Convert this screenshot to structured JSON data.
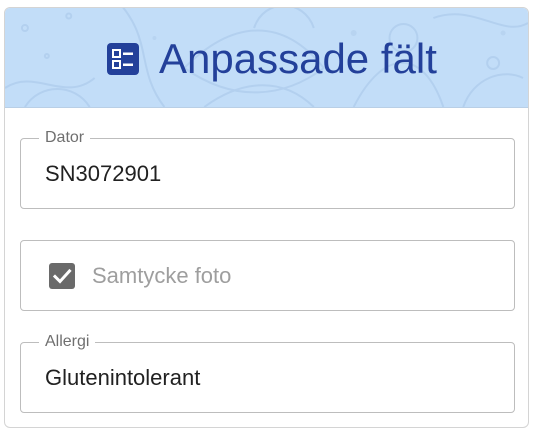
{
  "header": {
    "title": "Anpassade fält",
    "icon": "form-list-icon",
    "background_color": "#c2ddf8",
    "title_color": "#23409a"
  },
  "fields": {
    "dator": {
      "label": "Dator",
      "value": "SN3072901"
    },
    "consent": {
      "label": "Samtycke foto",
      "checked": true
    },
    "allergi": {
      "label": "Allergi",
      "value": "Glutenintolerant"
    }
  }
}
